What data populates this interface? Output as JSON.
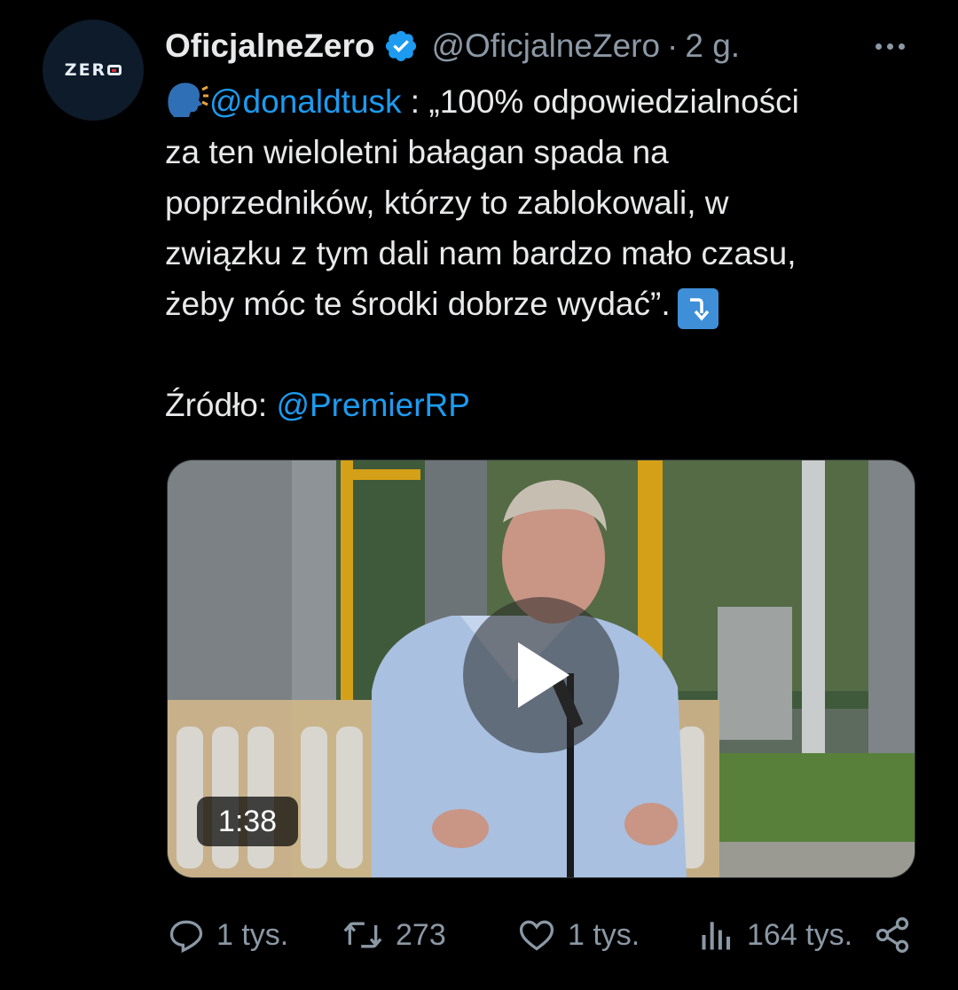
{
  "tweet": {
    "author_name": "OficjalneZero",
    "author_handle": "@OficjalneZero",
    "separator": "·",
    "time": "2 g.",
    "avatar_text": "ZER",
    "mention_handle": "@donaldtusk",
    "text_after_mention": " : „100% odpowiedzialności",
    "text_lines": [
      "za ten wieloletni bałagan spada na",
      "poprzedników, którzy to zablokowali, w",
      "związku z tym dali nam bardzo mało czasu,",
      "żeby móc te środki dobrze wydać”."
    ],
    "source_label": "Źródło: ",
    "source_handle": "@PremierRP",
    "video_duration": "1:38",
    "accent_color": "#1d9bf0"
  },
  "actions": {
    "replies": "1 tys.",
    "retweets": "273",
    "likes": "1 tys.",
    "views": "164 tys."
  },
  "icons": [
    "verified-badge-icon",
    "speaking-head-icon",
    "arrow-down-emoji-icon",
    "play-icon",
    "reply-icon",
    "retweet-icon",
    "like-icon",
    "views-icon",
    "share-icon",
    "more-icon"
  ]
}
